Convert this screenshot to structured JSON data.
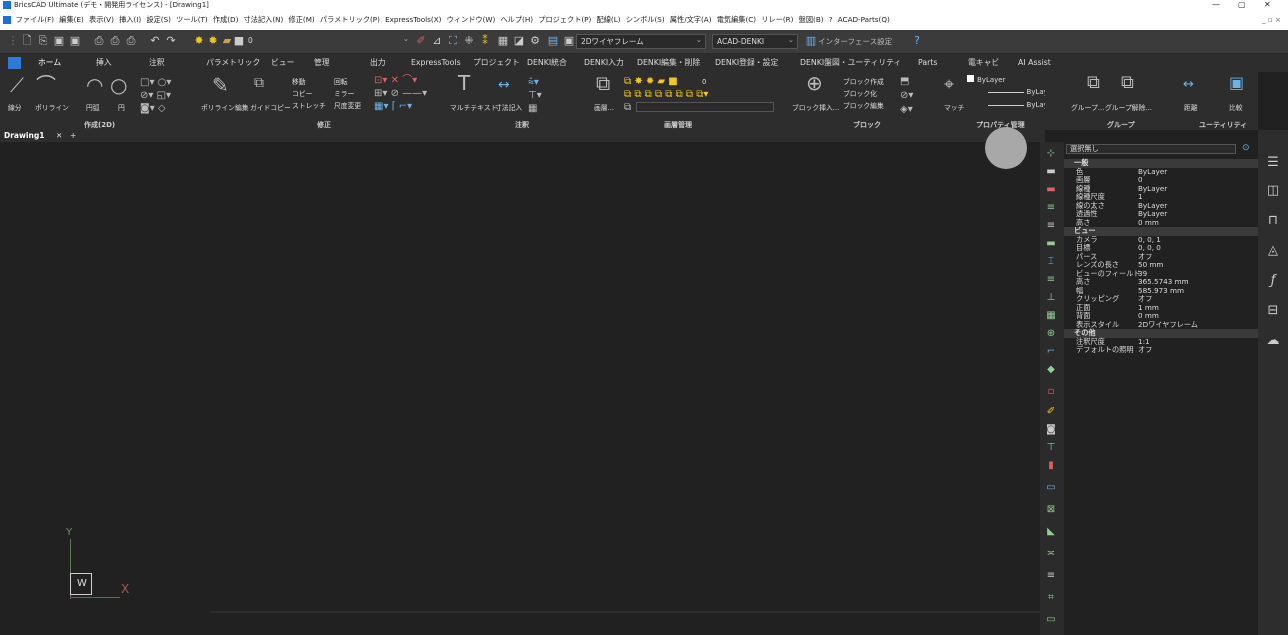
{
  "window": {
    "title": "BricsCAD Ultimate (デモ・開発用ライセンス) - [Drawing1]",
    "min": "—",
    "max": "▢",
    "close": "✕",
    "sub_controls": "_ ▫ ×"
  },
  "menu": [
    "ファイル(F)",
    "編集(E)",
    "表示(V)",
    "挿入(I)",
    "設定(S)",
    "ツール(T)",
    "作成(D)",
    "寸法記入(N)",
    "修正(M)",
    "パラメトリック(P)",
    "ExpressTools(X)",
    "ウィンドウ(W)",
    "ヘルプ(H)",
    "プロジェクト(P)",
    "配線(L)",
    "シンボル(S)",
    "属性/文字(A)",
    "電気編集(C)",
    "リレー(R)",
    "盤図(B)",
    "?",
    "ACAD-Parts(Q)"
  ],
  "quickaccess": {
    "layer_value": "0",
    "visual_style": "2Dワイヤフレーム",
    "workspace": "ACAD-DENKI",
    "interface_settings": "インターフェース設定"
  },
  "tabs": [
    "ホーム",
    "挿入",
    "注釈",
    "パラメトリック",
    "ビュー",
    "管理",
    "出力",
    "ExpressTools",
    "プロジェクト",
    "DENKI統合",
    "DENKI入力",
    "DENKI編集・削除",
    "DENKI登録・設定",
    "DENKI盤図・ユーティリティ",
    "Parts",
    "電キャビ",
    "AI Assist"
  ],
  "ribbon": {
    "draw": {
      "label": "作成(2D)",
      "line": "線分",
      "polyline": "ポリライン",
      "arc": "円弧",
      "circle": "円"
    },
    "modify": {
      "label": "修正",
      "pedit": "ポリライン編集",
      "guide_copy": "ガイドコピー",
      "move": "移動",
      "copy": "コピー",
      "stretch": "ストレッチ",
      "rotate": "回転",
      "mirror": "ミラー",
      "scale": "尺度変更"
    },
    "annotation": {
      "label": "注釈",
      "mtext": "マルチテキスト",
      "dim": "寸法記入"
    },
    "layers": {
      "label": "画層管理",
      "layer_btn": "画層...",
      "layer_value": "0"
    },
    "block": {
      "label": "ブロック",
      "insert": "ブロック挿入...",
      "create": "ブロック作成",
      "blockify": "ブロック化",
      "edit": "ブロック編集"
    },
    "props": {
      "label": "プロパティ管理",
      "match": "マッチ",
      "color": "ByLayer",
      "ltype": "ByLayer",
      "lweight": "ByLayer"
    },
    "group": {
      "label": "グループ",
      "group": "グループ...",
      "ungroup": "グループ解除..."
    },
    "utility": {
      "label": "ユーティリティ",
      "dist": "距離",
      "compare": "比較"
    }
  },
  "doc_tab": {
    "name": "Drawing1",
    "close": "✕",
    "add": "+"
  },
  "ucs": {
    "y": "Y",
    "x": "X",
    "w": "W"
  },
  "properties": {
    "selection": "選択無し",
    "sections": [
      {
        "title": "一般",
        "rows": [
          [
            "色",
            "ByLayer"
          ],
          [
            "画層",
            "0"
          ],
          [
            "線種",
            "ByLayer"
          ],
          [
            "線種尺度",
            "1"
          ],
          [
            "線の太さ",
            "ByLayer"
          ],
          [
            "透過性",
            "ByLayer"
          ],
          [
            "高さ",
            "0 mm"
          ]
        ]
      },
      {
        "title": "ビュー",
        "rows": [
          [
            "カメラ",
            "0, 0, 1"
          ],
          [
            "目標",
            "0, 0, 0"
          ],
          [
            "パース",
            "オフ"
          ],
          [
            "レンズの長さ",
            "50 mm"
          ],
          [
            "ビューのフィールド",
            "39"
          ],
          [
            "高さ",
            "365.5743 mm"
          ],
          [
            "幅",
            "585.973 mm"
          ],
          [
            "クリッピング",
            "オフ"
          ],
          [
            "正面",
            "1 mm"
          ],
          [
            "背面",
            "0 mm"
          ],
          [
            "表示スタイル",
            "2Dワイヤフレーム"
          ]
        ]
      },
      {
        "title": "その他",
        "rows": [
          [
            "注釈尺度",
            "1:1"
          ],
          [
            "デフォルトの照明",
            "オフ"
          ]
        ]
      }
    ]
  }
}
